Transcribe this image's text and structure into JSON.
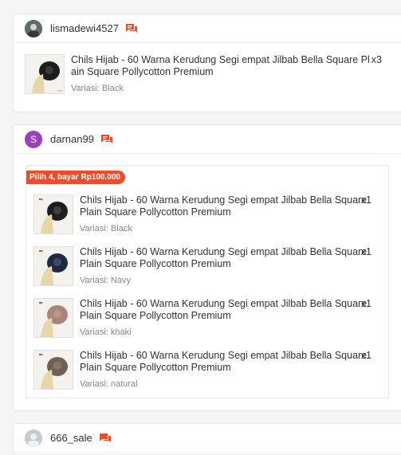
{
  "colors": {
    "accent": "#ee4d2d",
    "border": "#e5e5e5",
    "muted": "#888888"
  },
  "order1": {
    "username": "lismadewi4527",
    "avatar_icon": "profile-photo",
    "chat_icon": "chat-icon",
    "item": {
      "title": "Chils Hijab - 60 Warna Kerudung Segi empat Jilbab Bella Square Plain Square Pollycotton Premium",
      "title_line1": "Chils Hijab - 60 Warna Kerudung Segi empat Jilbab Bella Square Pl",
      "title_line2": "ain Square Pollycotton Premium",
      "qty": "x3",
      "variation": "Variasi: Black"
    }
  },
  "order2": {
    "username": "darnan99",
    "avatar_letter": "S",
    "chat_icon": "chat-icon",
    "promo_label": "Pilih 4, bayar Rp100.000",
    "items": [
      {
        "title": "Chils Hijab - 60 Warna Kerudung Segi empat Jilbab Bella Square Plain Square Pollycotton Premium",
        "qty": "x1",
        "variation": "Variasi: Black",
        "swatch": "#1f1f1f"
      },
      {
        "title": "Chils Hijab - 60 Warna Kerudung Segi empat Jilbab Bella Square Plain Square Pollycotton Premium",
        "qty": "x1",
        "variation": "Variasi: Navy",
        "swatch": "#1e2a44"
      },
      {
        "title": "Chils Hijab - 60 Warna Kerudung Segi empat Jilbab Bella Square Plain Square Pollycotton Premium",
        "qty": "x1",
        "variation": "Variasi: khaki",
        "swatch": "#a88579"
      },
      {
        "title": "Chils Hijab - 60 Warna Kerudung Segi empat Jilbab Bella Square Plain Square Pollycotton Premium",
        "qty": "x1",
        "variation": "Variasi: natural",
        "swatch": "#6f6153"
      }
    ]
  },
  "order3": {
    "username": "666_sale",
    "avatar_icon": "default-avatar",
    "chat_icon": "chat-icon"
  }
}
